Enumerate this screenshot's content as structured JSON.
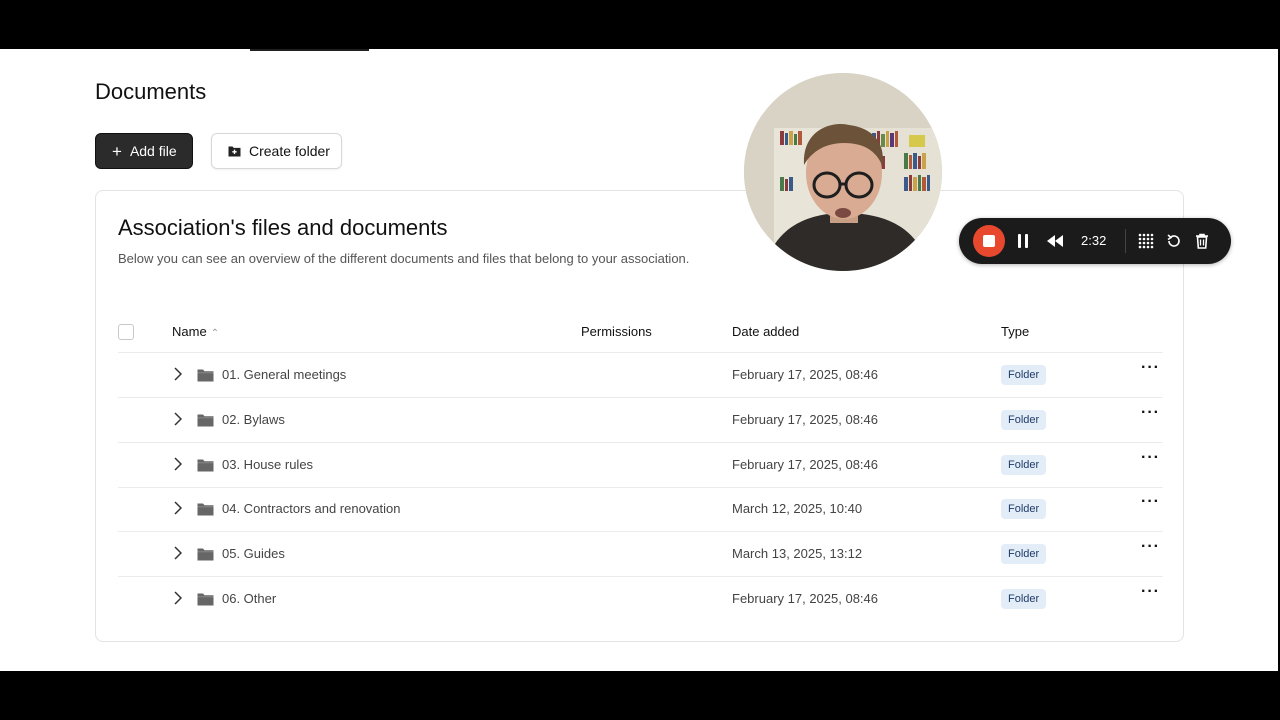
{
  "page": {
    "title": "Documents",
    "add_file_label": "Add file",
    "create_folder_label": "Create folder"
  },
  "card": {
    "title": "Association's files and documents",
    "subtitle": "Below you can see an overview of the different documents and files that belong to your association."
  },
  "table": {
    "columns": {
      "name": "Name",
      "permissions": "Permissions",
      "date_added": "Date added",
      "type": "Type"
    },
    "rows": [
      {
        "name": "01. General meetings",
        "date": "February 17, 2025, 08:46",
        "type": "Folder"
      },
      {
        "name": "02. Bylaws",
        "date": "February 17, 2025, 08:46",
        "type": "Folder"
      },
      {
        "name": "03. House rules",
        "date": "February 17, 2025, 08:46",
        "type": "Folder"
      },
      {
        "name": "04. Contractors and renovation",
        "date": "March 12, 2025, 10:40",
        "type": "Folder"
      },
      {
        "name": "05. Guides",
        "date": "March 13, 2025, 13:12",
        "type": "Folder"
      },
      {
        "name": "06. Other",
        "date": "February 17, 2025, 08:46",
        "type": "Folder"
      }
    ]
  },
  "recorder": {
    "timer": "2:32",
    "icons": [
      "stop-icon",
      "pause-icon",
      "rewind-icon",
      "grid-icon",
      "restart-icon",
      "trash-icon"
    ],
    "accent": "#e8492e"
  },
  "colors": {
    "badge_bg": "#e3edf7",
    "badge_text": "#1f3a68",
    "primary_button": "#2b2b2b"
  }
}
